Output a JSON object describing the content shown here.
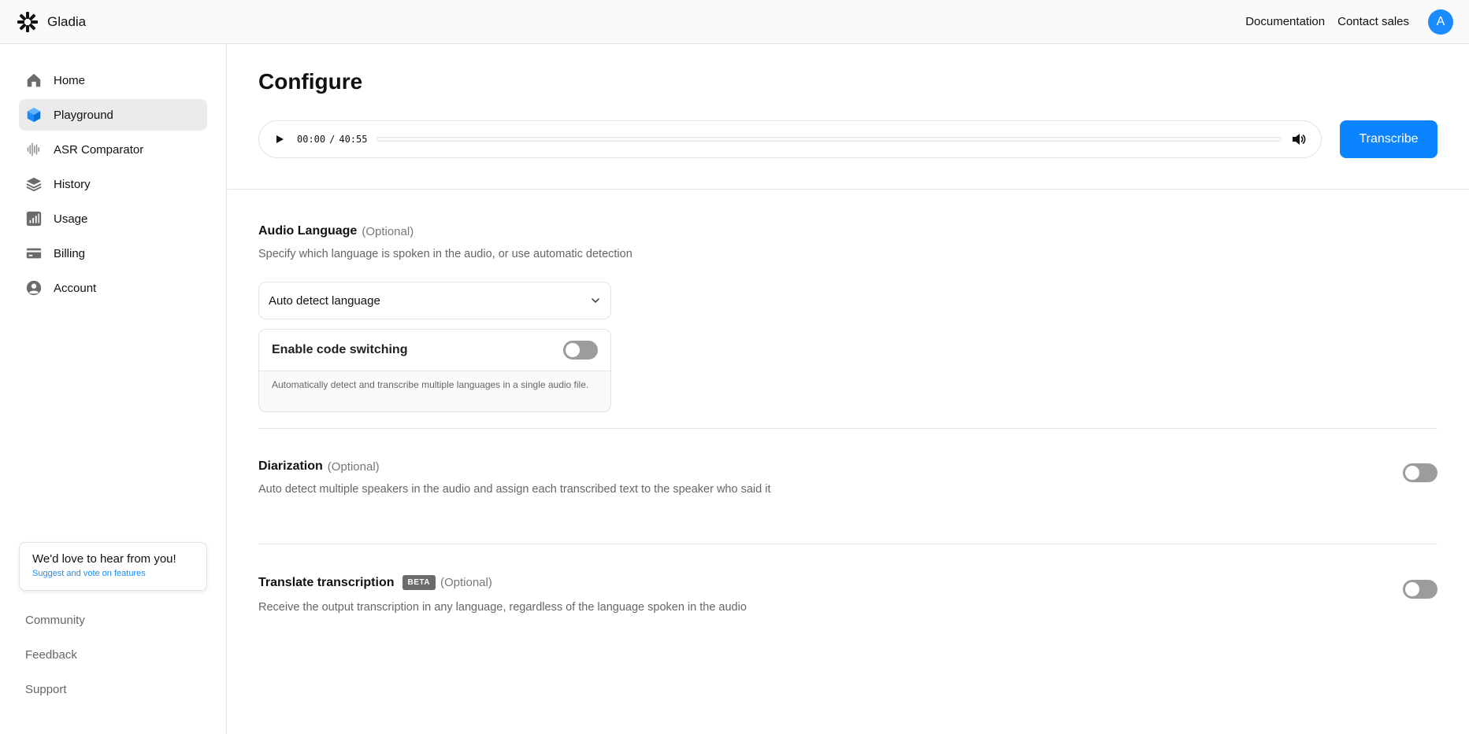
{
  "header": {
    "brand": "Gladia",
    "links": [
      "Documentation",
      "Contact sales"
    ],
    "avatar_initial": "A",
    "avatar_color": "#1a8cff"
  },
  "sidebar": {
    "items": [
      {
        "label": "Home",
        "icon": "home-icon",
        "active": false
      },
      {
        "label": "Playground",
        "icon": "cube-icon",
        "active": true
      },
      {
        "label": "ASR Comparator",
        "icon": "waveform-icon",
        "active": false
      },
      {
        "label": "History",
        "icon": "layers-icon",
        "active": false
      },
      {
        "label": "Usage",
        "icon": "bar-chart-icon",
        "active": false
      },
      {
        "label": "Billing",
        "icon": "credit-card-icon",
        "active": false
      },
      {
        "label": "Account",
        "icon": "user-circle-icon",
        "active": false
      }
    ],
    "feedback": {
      "title": "We'd love to hear from you!",
      "link": "Suggest and vote on features"
    },
    "footer_links": [
      "Community",
      "Feedback",
      "Support"
    ]
  },
  "main": {
    "title": "Configure",
    "player": {
      "current_time": "00:00",
      "separator": "/",
      "duration": "40:55",
      "progress": 0
    },
    "transcribe_label": "Transcribe",
    "accent_color": "#0a84ff",
    "audio_language": {
      "title": "Audio Language",
      "optional": "(Optional)",
      "description": "Specify which language is spoken in the audio, or use automatic detection",
      "select_value": "Auto detect language",
      "code_switching": {
        "title": "Enable code switching",
        "description": "Automatically detect and transcribe multiple languages in a single audio file.",
        "enabled": false
      }
    },
    "diarization": {
      "title": "Diarization",
      "optional": "(Optional)",
      "description": "Auto detect multiple speakers in the audio and assign each transcribed text to the speaker who said it",
      "enabled": false
    },
    "translate": {
      "title": "Translate transcription",
      "badge": "BETA",
      "optional": "(Optional)",
      "description": "Receive the output transcription in any language, regardless of the language spoken in the audio",
      "enabled": false
    }
  }
}
